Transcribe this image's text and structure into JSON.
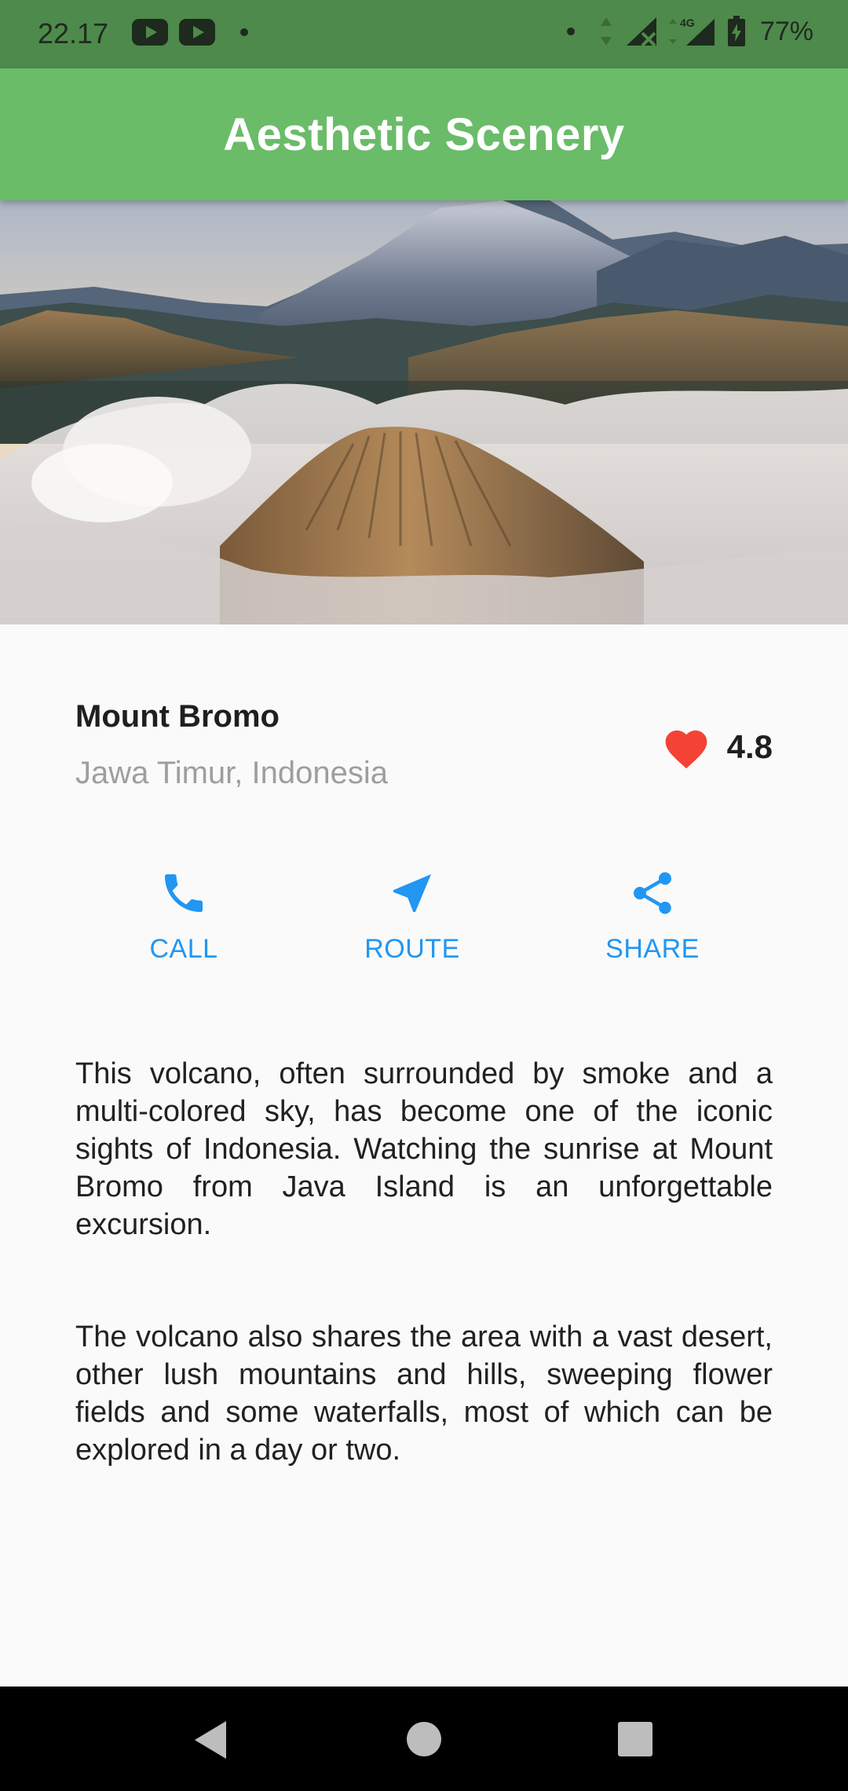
{
  "status_bar": {
    "time": "22.17",
    "left_icons": [
      "youtube-icon",
      "youtube-icon",
      "notification-dot-icon"
    ],
    "right_icons": [
      "dot-icon",
      "data-arrows-icon",
      "signal-icon",
      "4g-signal-icon",
      "battery-charging-icon"
    ],
    "network_label": "4G",
    "battery_text": "77%"
  },
  "app_bar": {
    "title": "Aesthetic Scenery",
    "color": "#6abc69"
  },
  "place": {
    "name": "Mount Bromo",
    "location": "Jawa Timur, Indonesia",
    "rating": "4.8",
    "heart_color": "#f44336"
  },
  "actions": [
    {
      "label": "CALL",
      "icon": "phone-icon"
    },
    {
      "label": "ROUTE",
      "icon": "navigation-icon"
    },
    {
      "label": "SHARE",
      "icon": "share-icon"
    }
  ],
  "accent_color": "#2196f3",
  "description": [
    "This volcano, often surrounded by smoke and a multi-colored sky, has become one of the iconic sights of Indonesia. Watching the sunrise at Mount Bromo from Java Island is an unforgettable excursion.",
    "The volcano also shares the area with a vast desert, other lush mountains and hills, sweeping flower fields and some waterfalls, most of which can be explored in a day or two."
  ],
  "nav_bar": {
    "buttons": [
      "back-icon",
      "home-icon",
      "recents-icon"
    ]
  }
}
